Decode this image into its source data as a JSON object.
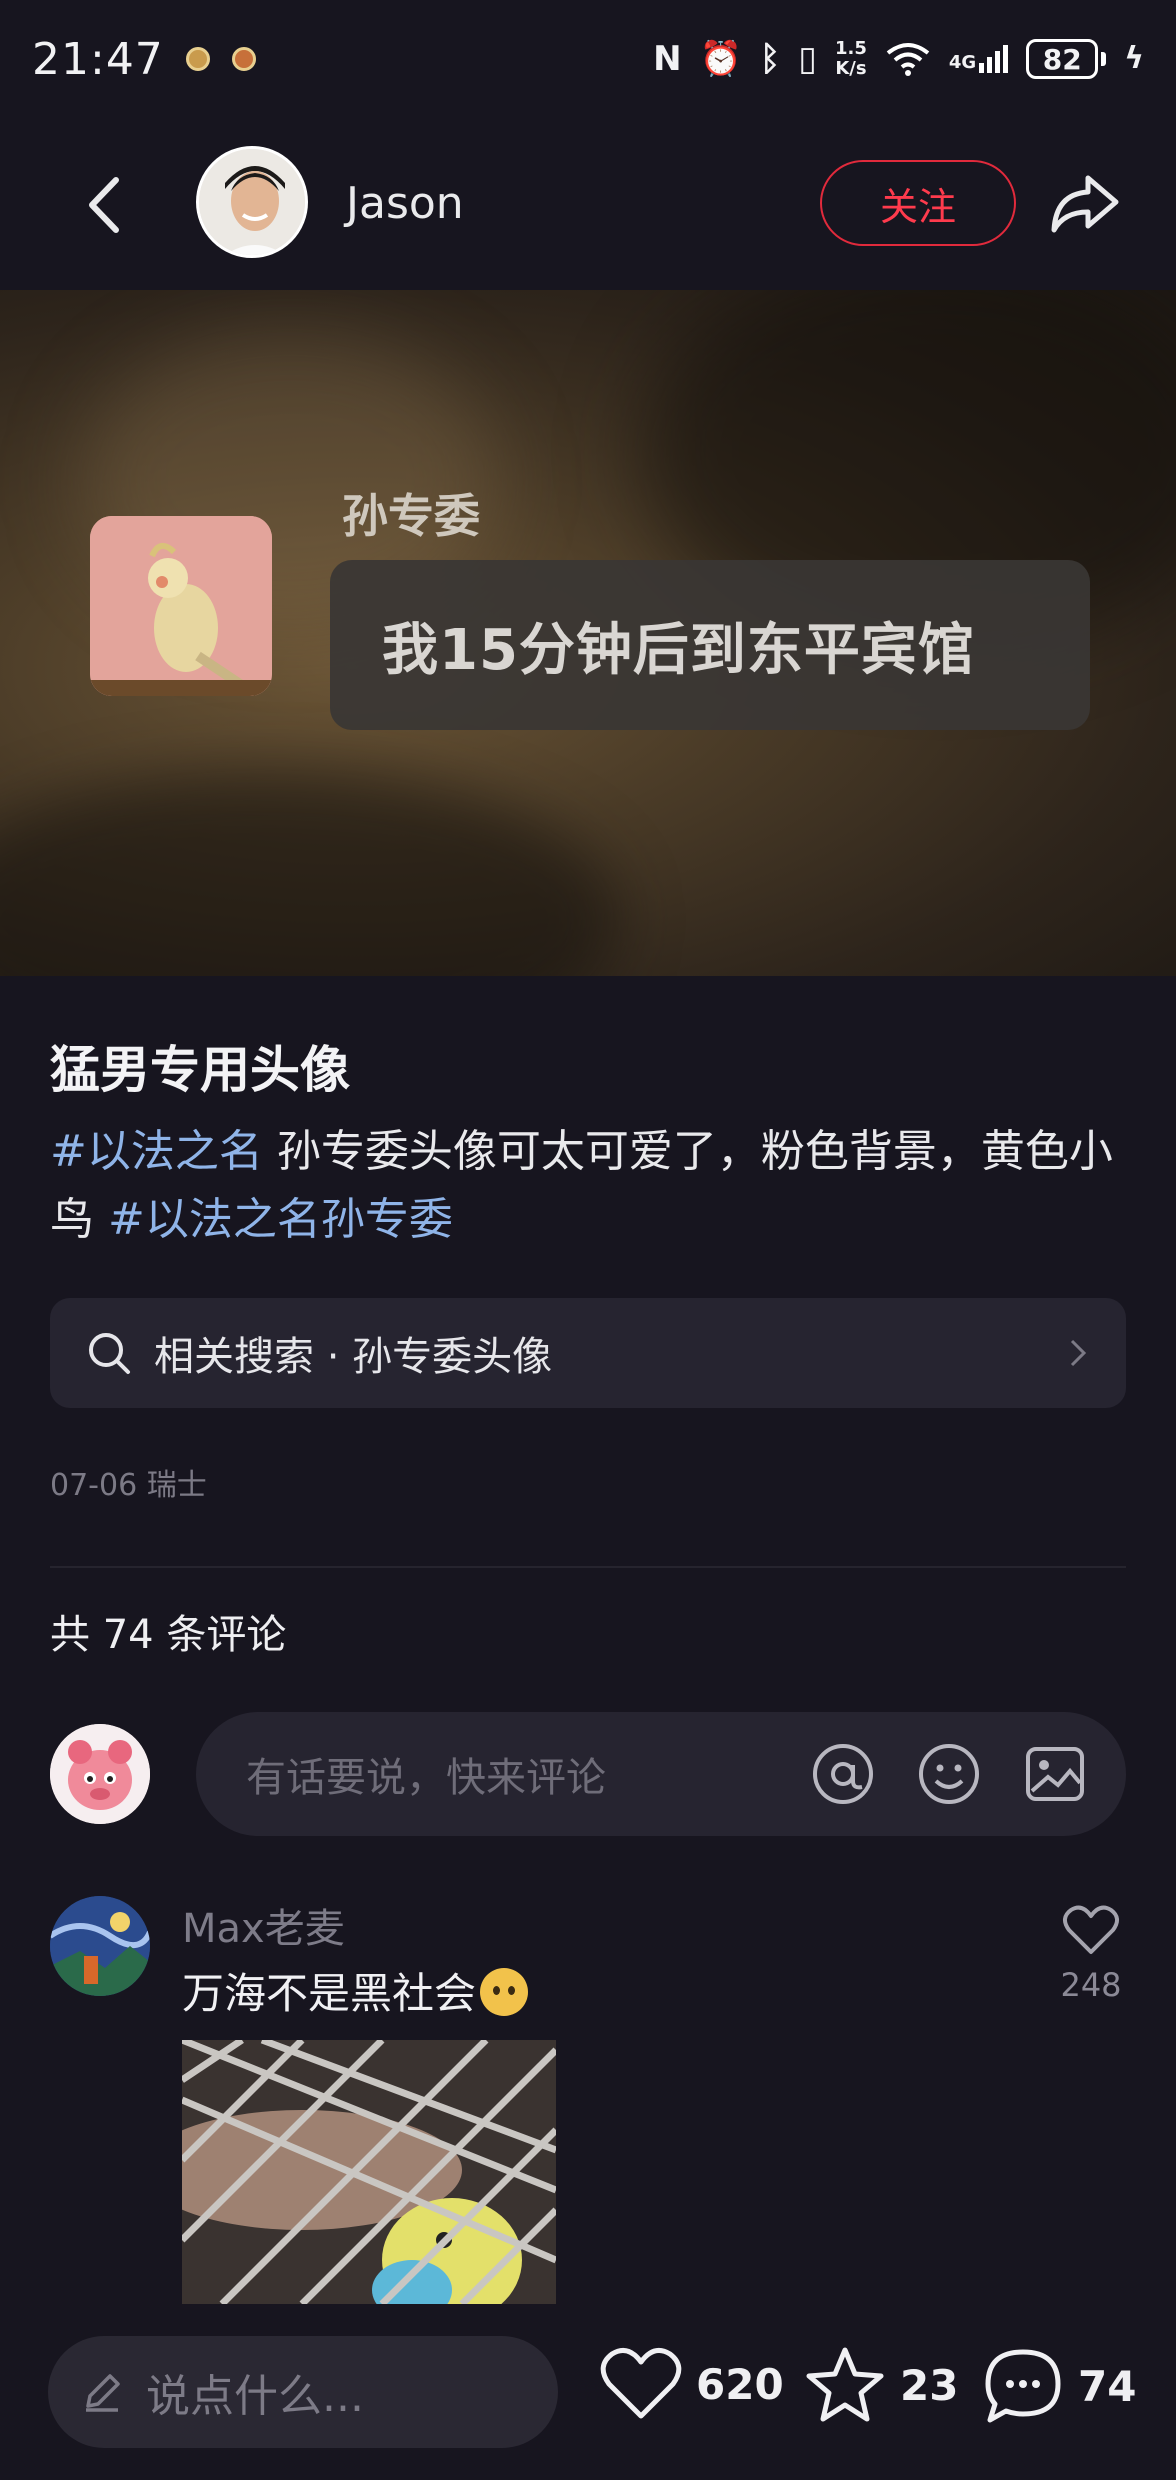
{
  "status_bar": {
    "time": "21:47",
    "net_speed_value": "1.5",
    "net_speed_unit": "K/s",
    "signal_label": "4G",
    "battery": "82"
  },
  "header": {
    "author_name": "Jason",
    "follow_label": "关注"
  },
  "hero": {
    "chat_sender": "孙专委",
    "chat_message": "我15分钟后到东平宾馆"
  },
  "post": {
    "title": "猛男专用头像",
    "tag1": "#以法之名",
    "body": " 孙专委头像可太可爱了，粉色背景，黄色小鸟 ",
    "tag2": "#以法之名孙专委",
    "related_search": "相关搜索 · 孙专委头像",
    "meta": "07-06 瑞士"
  },
  "comments": {
    "count_label": "共 74 条评论",
    "input_placeholder": "有话要说，快来评论",
    "items": [
      {
        "user": "Max老麦",
        "text": "万海不是黑社会",
        "likes": "248"
      }
    ]
  },
  "bottom_bar": {
    "input_placeholder": "说点什么...",
    "like_count": "620",
    "collect_count": "23",
    "comment_count": "74"
  },
  "colors": {
    "background": "#17151f",
    "accent_red": "#ff3b4d",
    "tag_blue": "#8fb4e8",
    "panel": "#262430"
  }
}
